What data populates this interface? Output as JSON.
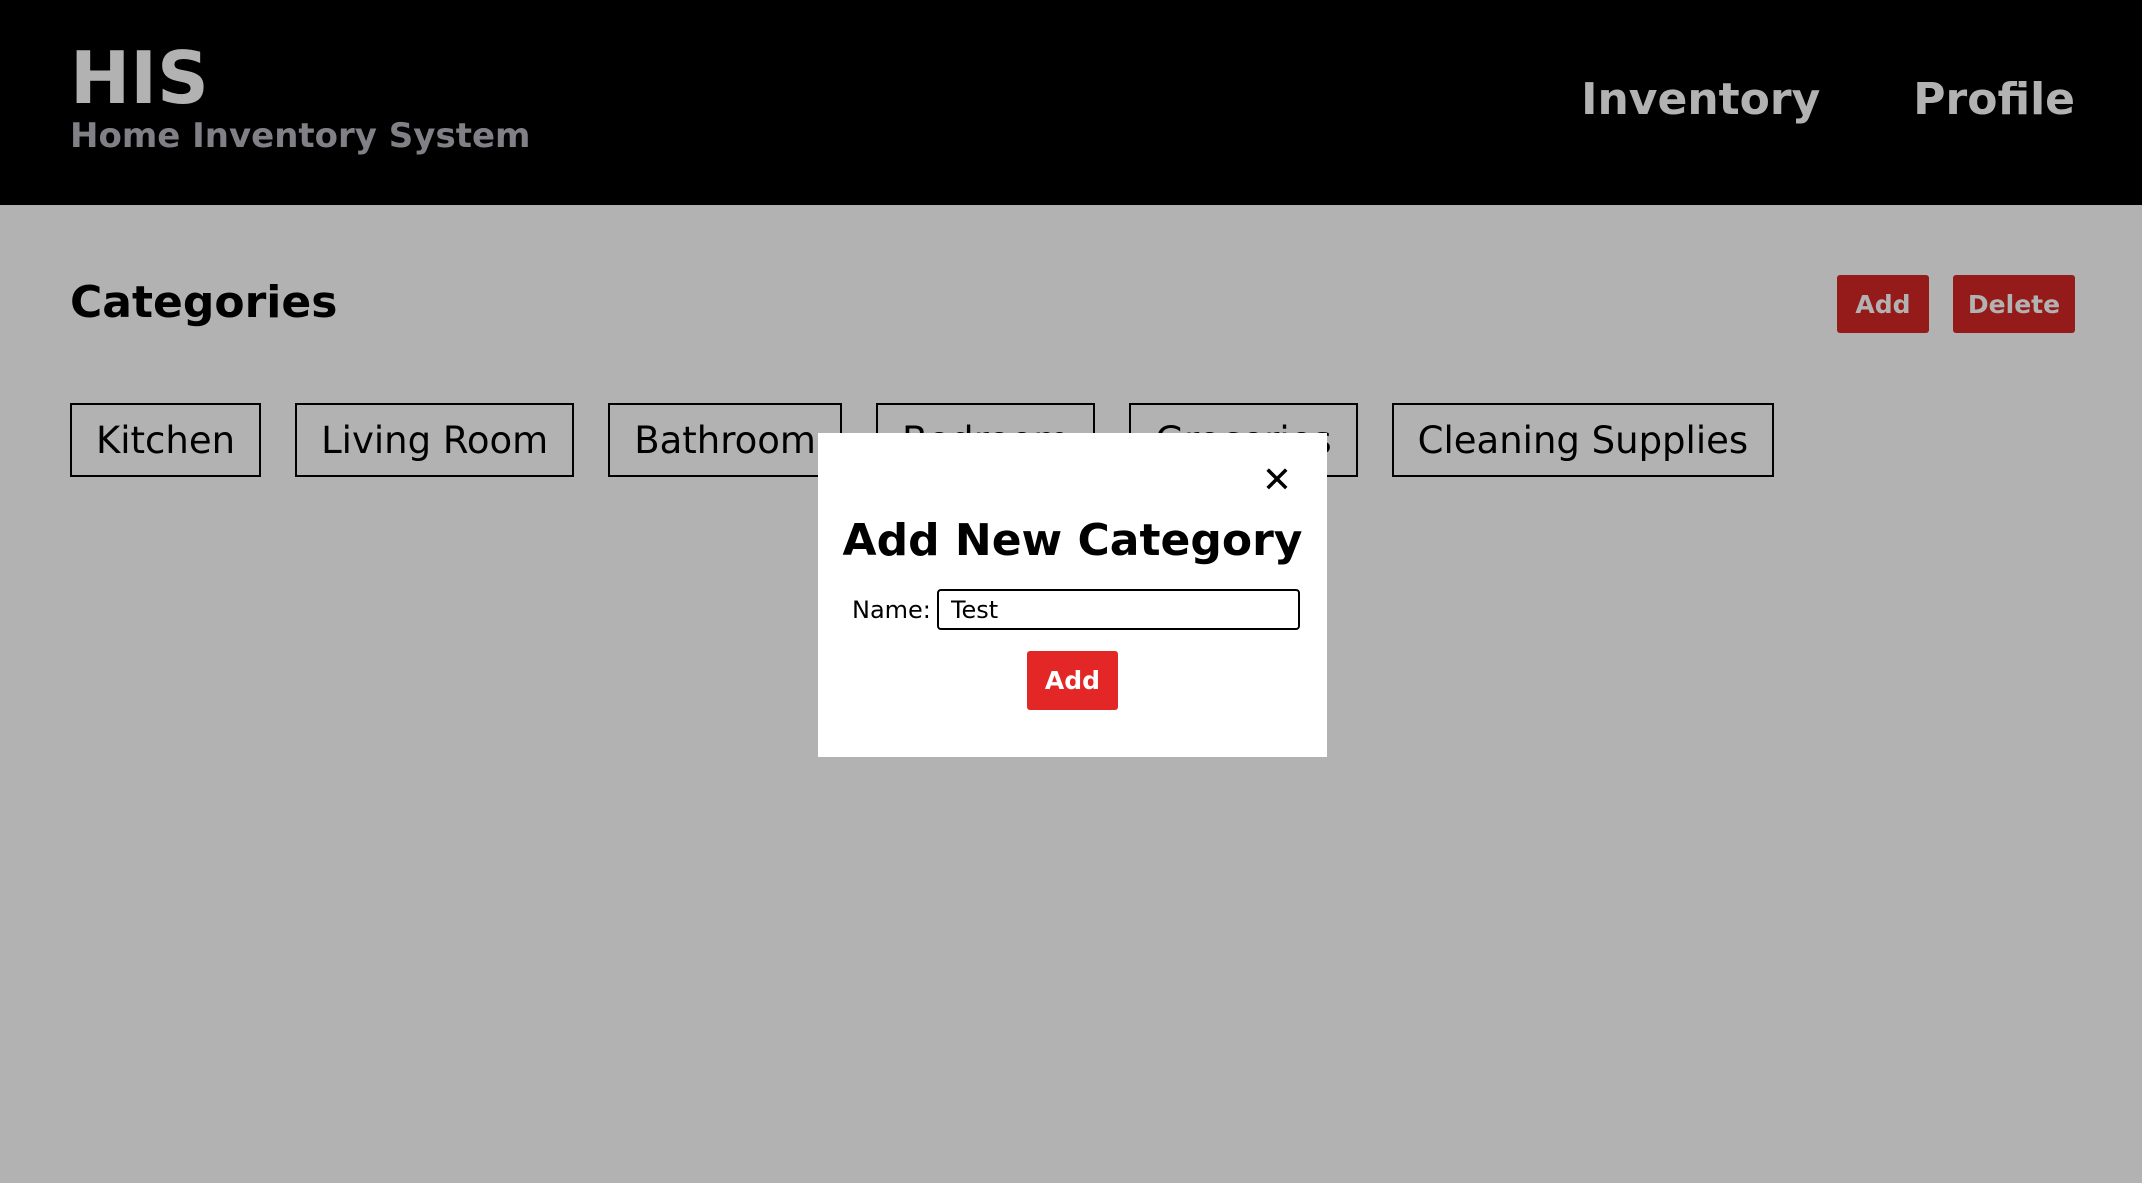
{
  "header": {
    "brand_title": "HIS",
    "brand_subtitle": "Home Inventory System",
    "nav": {
      "inventory": "Inventory",
      "profile": "Profile"
    }
  },
  "main": {
    "section_title": "Categories",
    "add_label": "Add",
    "delete_label": "Delete",
    "categories": [
      "Kitchen",
      "Living Room",
      "Bathroom",
      "Bedroom",
      "Groceries",
      "Cleaning Supplies"
    ]
  },
  "modal": {
    "close_icon": "close-icon",
    "title": "Add New Category",
    "name_label": "Name:",
    "name_value": "Test",
    "add_label": "Add"
  },
  "colors": {
    "header_bg": "#000000",
    "accent_red": "#d62828",
    "overlay": "rgba(0,0,0,0.30)"
  }
}
